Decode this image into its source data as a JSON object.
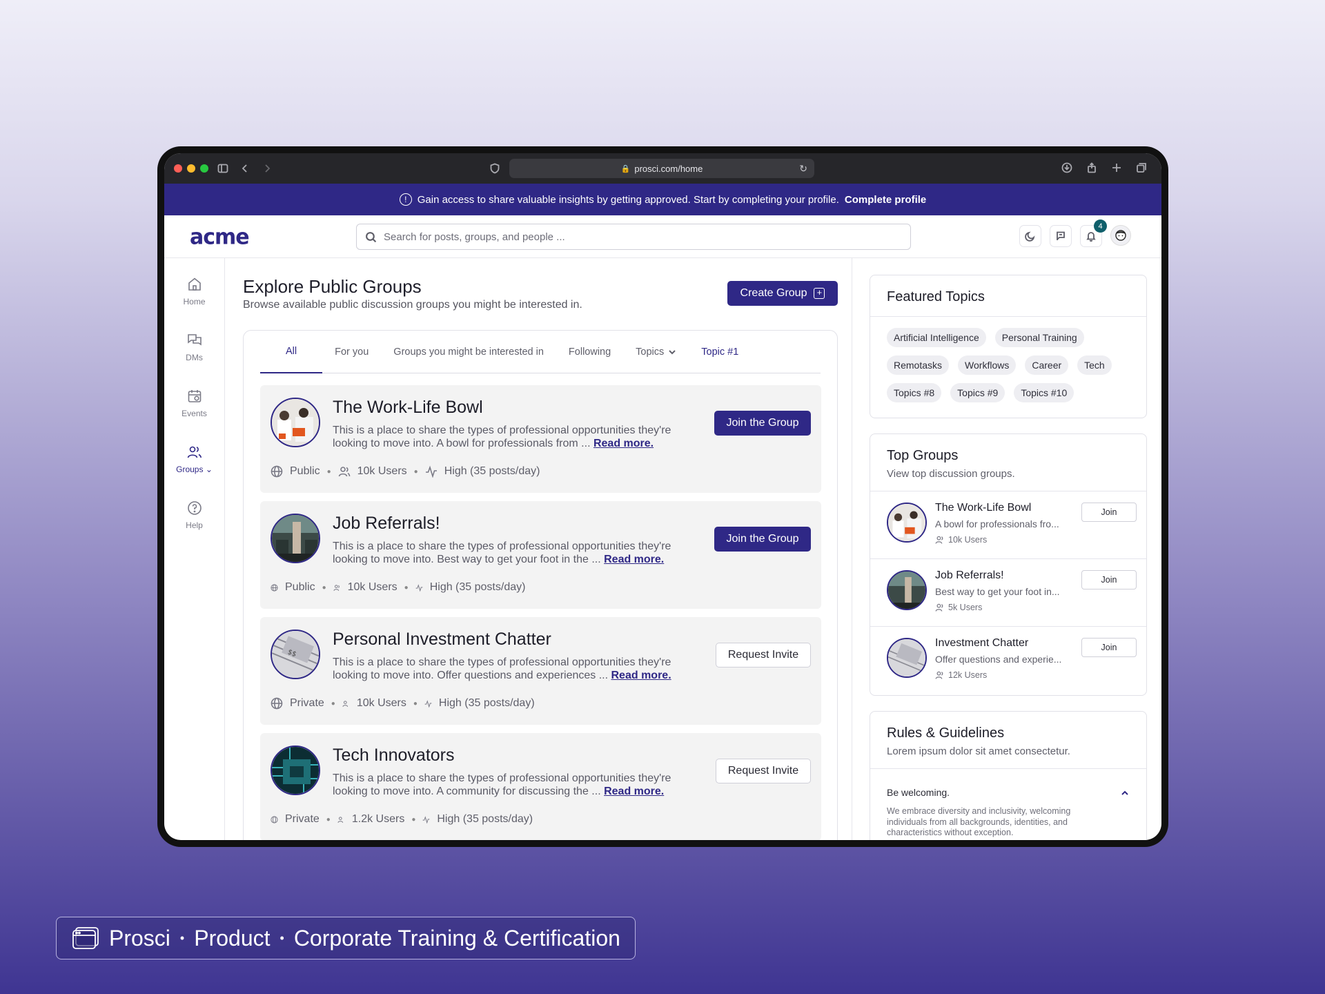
{
  "browser": {
    "url": "prosci.com/home"
  },
  "banner": {
    "text": "Gain access to share valuable insights by getting approved. Start by completing your profile.",
    "link": "Complete profile"
  },
  "header": {
    "logo": "acme",
    "search_placeholder": "Search for posts, groups, and people ...",
    "notification_count": "4"
  },
  "sidebar": {
    "items": [
      {
        "label": "Home"
      },
      {
        "label": "DMs"
      },
      {
        "label": "Events"
      },
      {
        "label": "Groups"
      },
      {
        "label": "Help"
      }
    ]
  },
  "main": {
    "title": "Explore Public Groups",
    "subtitle": "Browse available public discussion groups you might be interested in.",
    "create_button": "Create Group",
    "tabs": [
      "All",
      "For you",
      "Groups you might be interested in",
      "Following",
      "Topics",
      "Topic #1"
    ],
    "groups": [
      {
        "name": "The Work-Life Bowl",
        "desc": "This is a place to share the types of professional opportunities they're looking to move into. A bowl for professionals from ...",
        "read_more": "Read more.",
        "visibility": "Public",
        "users": "10k Users",
        "activity": "High (35 posts/day)",
        "button": "Join the Group"
      },
      {
        "name": "Job Referrals!",
        "desc": "This is a place to share the types of professional opportunities they're looking to move into. Best way to get your foot in the ...",
        "read_more": "Read more.",
        "visibility": "Public",
        "users": "10k Users",
        "activity": "High (35 posts/day)",
        "button": "Join the Group"
      },
      {
        "name": "Personal Investment Chatter",
        "desc": "This is a place to share the types of professional opportunities they're looking to move into. Offer questions and experiences ...",
        "read_more": "Read more.",
        "visibility": "Private",
        "users": "10k Users",
        "activity": "High (35 posts/day)",
        "button": "Request Invite"
      },
      {
        "name": "Tech Innovators",
        "desc": "This is a place to share the types of professional opportunities they're looking to move into. A community for discussing the ...",
        "read_more": "Read more.",
        "visibility": "Private",
        "users": "1.2k Users",
        "activity": "High (35 posts/day)",
        "button": "Request Invite"
      }
    ]
  },
  "featured_topics": {
    "title": "Featured Topics",
    "chips": [
      "Artificial Intelligence",
      "Personal Training",
      "Remotasks",
      "Workflows",
      "Career",
      "Tech",
      "Topics #8",
      "Topics #9",
      "Topics #10"
    ]
  },
  "top_groups": {
    "title": "Top Groups",
    "subtitle": "View top discussion groups.",
    "items": [
      {
        "name": "The Work-Life Bowl",
        "desc": "A bowl for professionals fro...",
        "users": "10k Users",
        "button": "Join"
      },
      {
        "name": "Job Referrals!",
        "desc": "Best way to get your foot in...",
        "users": "5k Users",
        "button": "Join"
      },
      {
        "name": "Investment Chatter",
        "desc": "Offer questions and experie...",
        "users": "12k Users",
        "button": "Join"
      }
    ]
  },
  "rules": {
    "title": "Rules & Guidelines",
    "subtitle": "Lorem ipsum dolor sit amet consectetur.",
    "q1": "Be welcoming.",
    "a1": "We embrace diversity and inclusivity, welcoming individuals from all backgrounds, identities, and characteristics without exception."
  },
  "caption": {
    "brand": "Prosci",
    "part2": "Product",
    "part3": "Corporate Training & Certification"
  }
}
